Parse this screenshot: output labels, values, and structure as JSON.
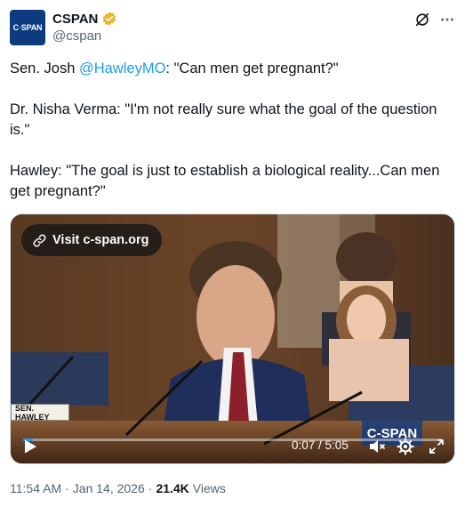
{
  "author": {
    "display_name": "CSPAN",
    "handle": "@cspan",
    "avatar_text_left": "C",
    "avatar_text_dot": "·",
    "avatar_text_right": "SPAN",
    "avatar_color": "#0d3b80",
    "verified_color": "#e8b829"
  },
  "tweet": {
    "line1_prefix": "Sen. Josh ",
    "line1_mention": "@HawleyMO",
    "line1_suffix": ": \"Can men get pregnant?\"",
    "paragraph2": "Dr. Nisha Verma: \"I'm not really sure what the goal of the question is.\"",
    "paragraph3": "Hawley: \"The goal is just to establish a biological reality...Can men get pregnant?\""
  },
  "video": {
    "visit_label": "Visit c-span.org",
    "nameplate": "SEN. HAWLEY",
    "watermark": "C-SPAN",
    "current_time": "0:07",
    "duration": "5:05",
    "time_separator": " / ",
    "progress_fraction": 0.023
  },
  "meta": {
    "time": "11:54 AM",
    "separator": "·",
    "date": "Jan 14, 2026",
    "views_count": "21.4K",
    "views_label": "Views"
  },
  "icons": {
    "grok": "grok-icon",
    "more": "more-icon",
    "link": "link-icon",
    "play": "play-icon",
    "mute": "mute-icon",
    "settings": "settings-icon",
    "fullscreen": "fullscreen-icon"
  },
  "colors": {
    "link_blue": "#1d9bf0",
    "secondary_text": "#536471"
  }
}
